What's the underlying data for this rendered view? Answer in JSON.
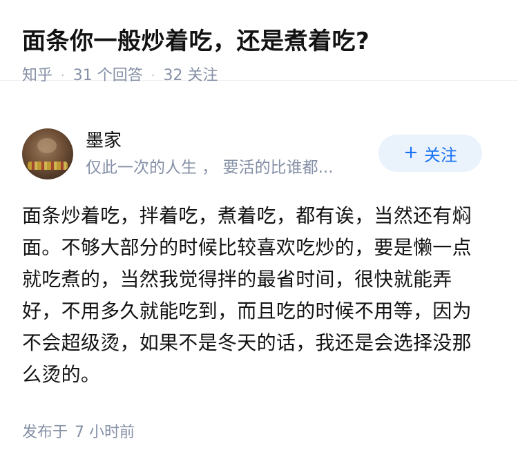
{
  "question": {
    "title": "面条你一般炒着吃，还是煮着吃?",
    "source": "知乎",
    "answer_count": "31 个回答",
    "follower_count": "32 关注"
  },
  "author": {
    "name": "墨家",
    "bio": "仅此一次的人生 ， 要活的比谁都...",
    "follow_plus": "+",
    "follow_label": "关注"
  },
  "answer": {
    "text": "面条炒着吃，拌着吃，煮着吃，都有诶，当然还有焖面。不够大部分的时候比较喜欢吃炒的，要是懒一点就吃煮的，当然我觉得拌的最省时间，很快就能弄好，不用多久就能吃到，而且吃的时候不用等，因为不会超级烫，如果不是冬天的话，我还是会选择没那么烫的。",
    "published_label": "发布于",
    "published_time": "7 小时前"
  }
}
